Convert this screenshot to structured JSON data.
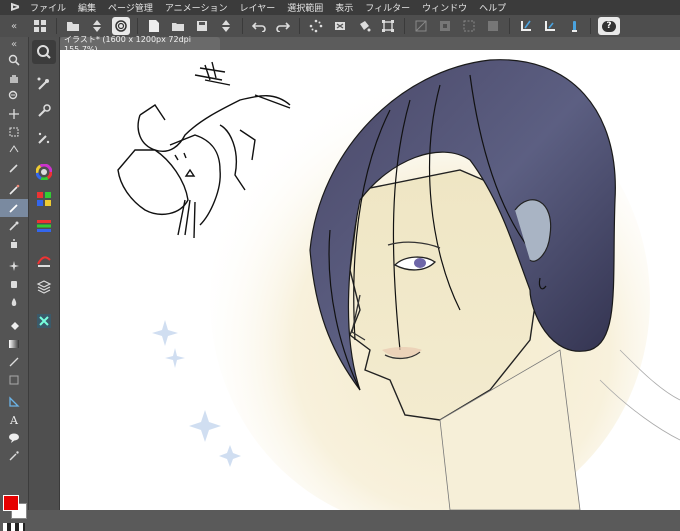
{
  "menubar": {
    "items": [
      "ファイル",
      "編集",
      "ページ管理",
      "アニメーション",
      "レイヤー",
      "選択範囲",
      "表示",
      "フィルター",
      "ウィンドウ",
      "ヘルプ"
    ]
  },
  "toolbar": {
    "help_label": "?"
  },
  "document": {
    "tab_label": "イラスト* (1600 x 1200px 72dpi 155.7%)"
  },
  "colors": {
    "foreground": "#e60000",
    "background": "#ffffff",
    "ui_bg": "#5a5a5a"
  },
  "tools": [
    "zoom-icon",
    "hand-icon",
    "zoom-out-icon",
    "move-icon",
    "select-rect-icon",
    "lasso-icon",
    "eyedropper-icon",
    "pen-icon",
    "pencil-icon",
    "brush-icon",
    "airbrush-icon",
    "decoration-icon",
    "eraser-icon",
    "blend-icon",
    "fill-icon",
    "gradient-icon",
    "figure-icon",
    "frame-icon",
    "ruler-icon",
    "text-icon",
    "balloon-icon",
    "correction-icon"
  ],
  "active_tool_index": 8
}
